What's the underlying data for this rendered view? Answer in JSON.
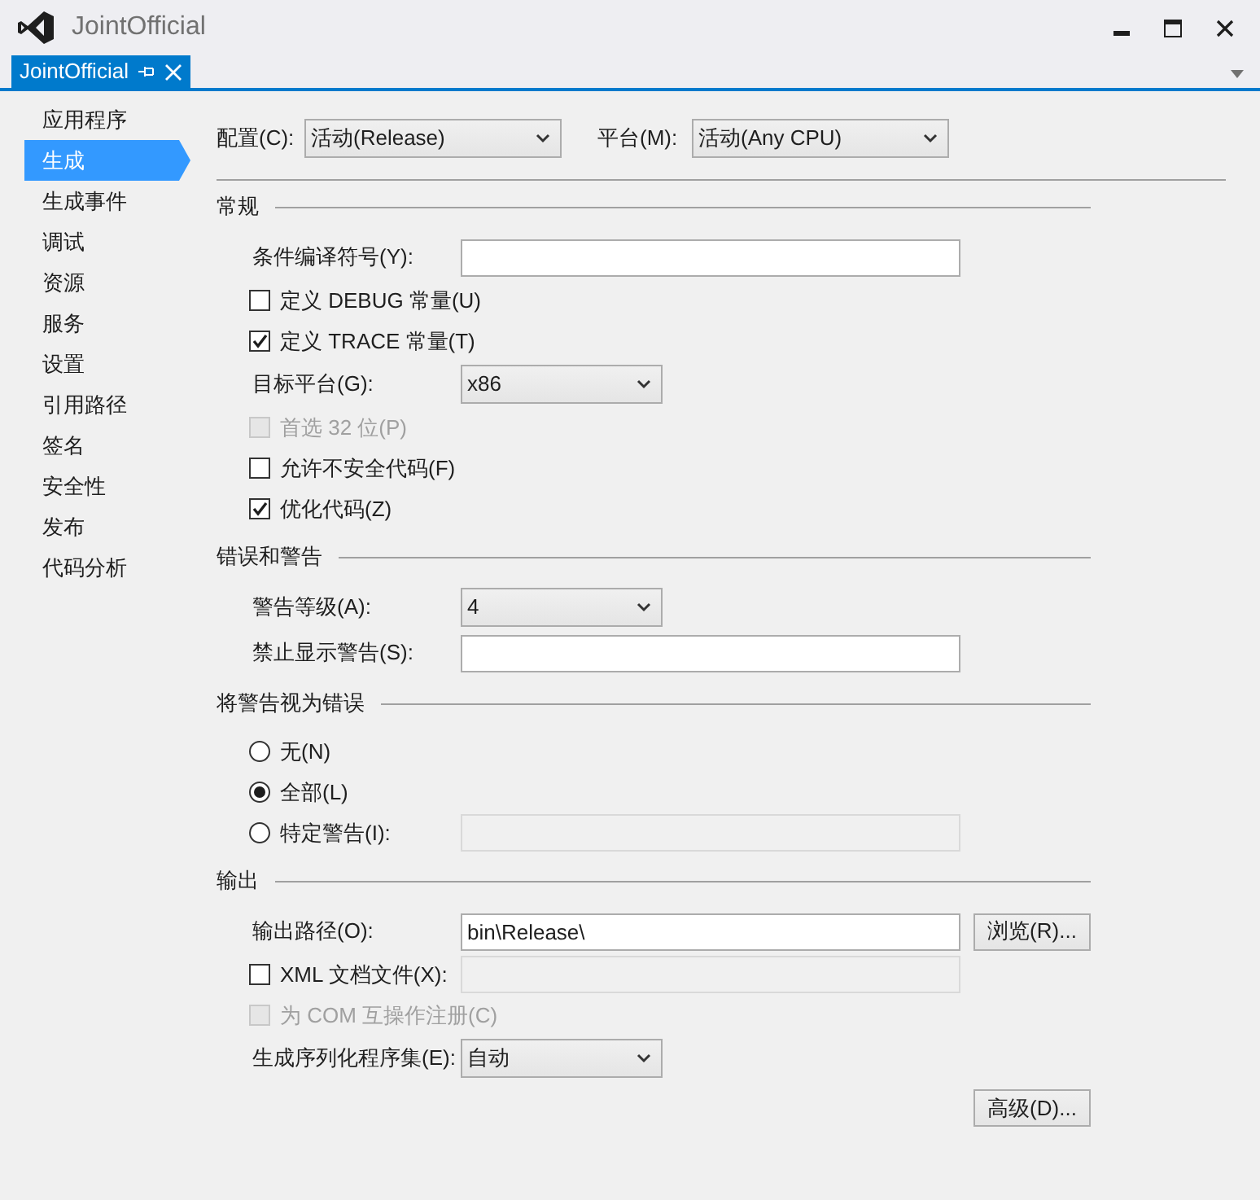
{
  "window": {
    "title": "JointOfficial"
  },
  "document_tab": {
    "label": "JointOfficial",
    "selected": true
  },
  "sidebar": {
    "items": [
      {
        "label": "应用程序",
        "selected": false
      },
      {
        "label": "生成",
        "selected": true
      },
      {
        "label": "生成事件",
        "selected": false
      },
      {
        "label": "调试",
        "selected": false
      },
      {
        "label": "资源",
        "selected": false
      },
      {
        "label": "服务",
        "selected": false
      },
      {
        "label": "设置",
        "selected": false
      },
      {
        "label": "引用路径",
        "selected": false
      },
      {
        "label": "签名",
        "selected": false
      },
      {
        "label": "安全性",
        "selected": false
      },
      {
        "label": "发布",
        "selected": false
      },
      {
        "label": "代码分析",
        "selected": false
      }
    ]
  },
  "configuration": {
    "label": "配置(C):",
    "value": "活动(Release)"
  },
  "platform": {
    "label": "平台(M):",
    "value": "活动(Any CPU)"
  },
  "sections": [
    {
      "title": "常规",
      "rows": [
        {
          "kind": "text",
          "label": "条件编译符号(Y):",
          "value": ""
        },
        {
          "kind": "checkbox",
          "label": "定义 DEBUG 常量(U)",
          "checked": false,
          "disabled": false
        },
        {
          "kind": "checkbox",
          "label": "定义 TRACE 常量(T)",
          "checked": true,
          "disabled": false
        },
        {
          "kind": "dropdown",
          "label": "目标平台(G):",
          "value": "x86"
        },
        {
          "kind": "checkbox",
          "label": "首选 32 位(P)",
          "checked": false,
          "disabled": true
        },
        {
          "kind": "checkbox",
          "label": "允许不安全代码(F)",
          "checked": false,
          "disabled": false
        },
        {
          "kind": "checkbox",
          "label": "优化代码(Z)",
          "checked": true,
          "disabled": false
        }
      ]
    },
    {
      "title": "错误和警告",
      "rows": [
        {
          "kind": "dropdown",
          "label": "警告等级(A):",
          "value": "4"
        },
        {
          "kind": "text",
          "label": "禁止显示警告(S):",
          "value": ""
        }
      ]
    },
    {
      "title": "将警告视为错误",
      "rows": [
        {
          "kind": "radio",
          "label": "无(N)",
          "selected": false
        },
        {
          "kind": "radio",
          "label": "全部(L)",
          "selected": true
        },
        {
          "kind": "radio",
          "label": "特定警告(I):",
          "selected": false,
          "field": {
            "disabled": true
          }
        }
      ]
    },
    {
      "title": "输出",
      "rows": [
        {
          "kind": "text",
          "label": "输出路径(O):",
          "value": "bin\\Release\\",
          "button": "浏览(R)..."
        },
        {
          "kind": "checkbox",
          "label": "XML 文档文件(X):",
          "checked": false,
          "disabled": false,
          "field": {
            "disabled": true
          }
        },
        {
          "kind": "checkbox",
          "label": "为 COM 互操作注册(C)",
          "checked": false,
          "disabled": true
        },
        {
          "kind": "dropdown",
          "label": "生成序列化程序集(E):",
          "value": "自动"
        }
      ]
    }
  ],
  "advanced_button": "高级(D)..."
}
